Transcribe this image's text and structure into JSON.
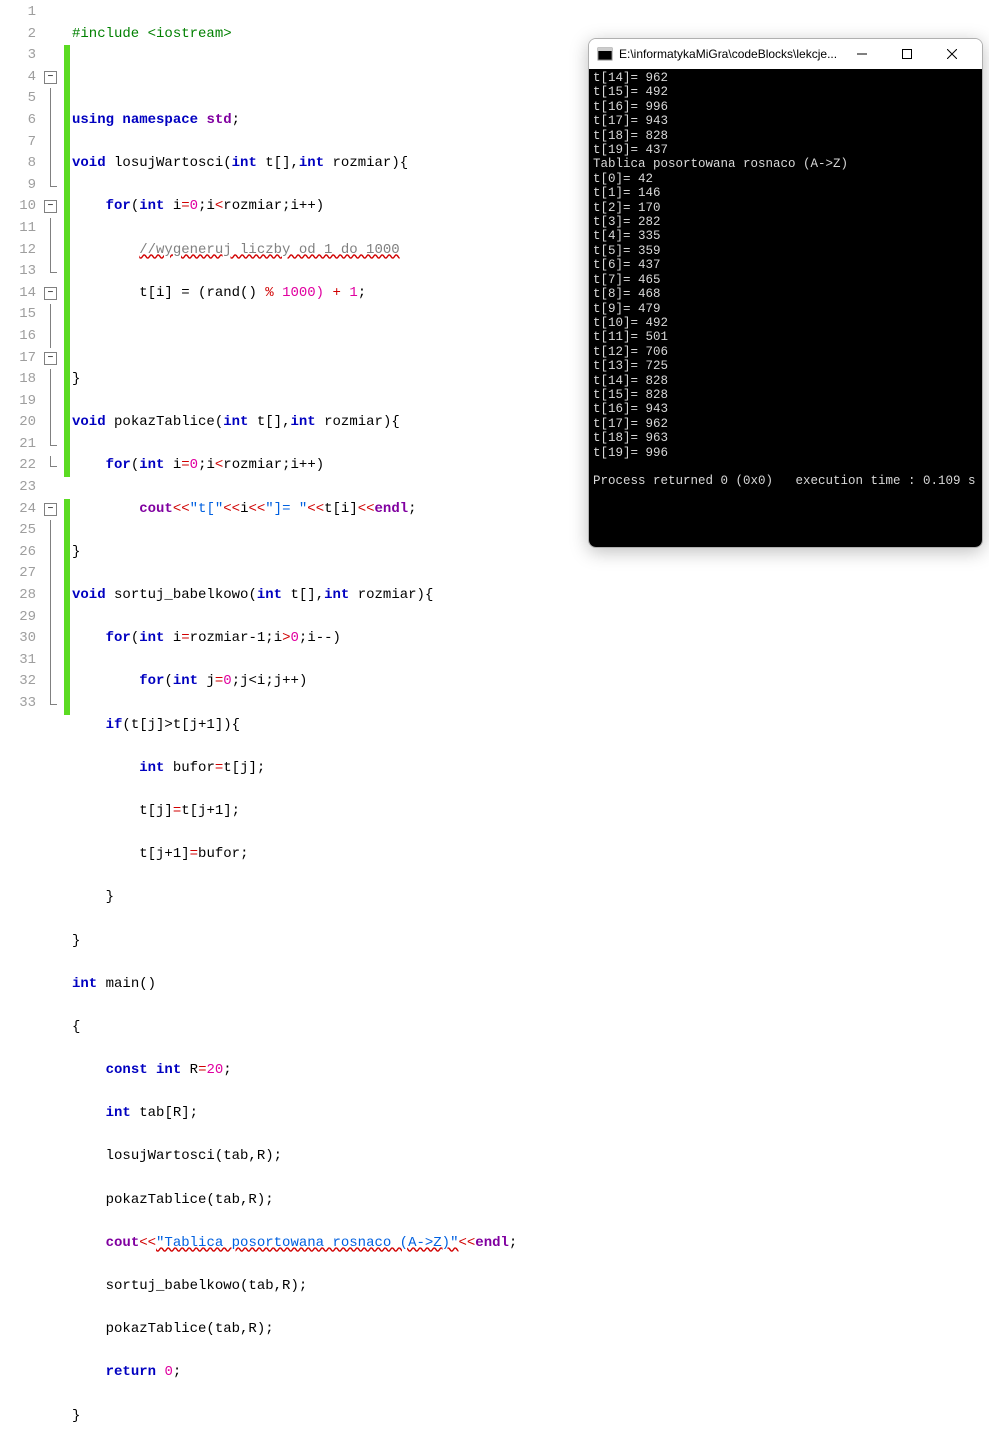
{
  "editor": {
    "lines": [
      {
        "n": 1,
        "fold": null,
        "bar": false
      },
      {
        "n": 2,
        "fold": null,
        "bar": false
      },
      {
        "n": 3,
        "fold": null,
        "bar": true
      },
      {
        "n": 4,
        "fold": "box",
        "bar": true
      },
      {
        "n": 5,
        "fold": "v",
        "bar": true
      },
      {
        "n": 6,
        "fold": "v",
        "bar": true
      },
      {
        "n": 7,
        "fold": "v",
        "bar": true
      },
      {
        "n": 8,
        "fold": "v",
        "bar": true
      },
      {
        "n": 9,
        "fold": "end",
        "bar": true
      },
      {
        "n": 10,
        "fold": "box",
        "bar": true
      },
      {
        "n": 11,
        "fold": "v",
        "bar": true
      },
      {
        "n": 12,
        "fold": "v",
        "bar": true
      },
      {
        "n": 13,
        "fold": "end",
        "bar": true
      },
      {
        "n": 14,
        "fold": "box",
        "bar": true
      },
      {
        "n": 15,
        "fold": "v",
        "bar": true
      },
      {
        "n": 16,
        "fold": "v",
        "bar": true
      },
      {
        "n": 17,
        "fold": "box",
        "bar": true
      },
      {
        "n": 18,
        "fold": "v",
        "bar": true
      },
      {
        "n": 19,
        "fold": "v",
        "bar": true
      },
      {
        "n": 20,
        "fold": "v",
        "bar": true
      },
      {
        "n": 21,
        "fold": "end",
        "bar": true
      },
      {
        "n": 22,
        "fold": "end",
        "bar": true
      },
      {
        "n": 23,
        "fold": null,
        "bar": false
      },
      {
        "n": 24,
        "fold": "box",
        "bar": true
      },
      {
        "n": 25,
        "fold": "v",
        "bar": true
      },
      {
        "n": 26,
        "fold": "v",
        "bar": true
      },
      {
        "n": 27,
        "fold": "v",
        "bar": true
      },
      {
        "n": 28,
        "fold": "v",
        "bar": true
      },
      {
        "n": 29,
        "fold": "v",
        "bar": true
      },
      {
        "n": 30,
        "fold": "v",
        "bar": true
      },
      {
        "n": 31,
        "fold": "v",
        "bar": true
      },
      {
        "n": 32,
        "fold": "v",
        "bar": true
      },
      {
        "n": 33,
        "fold": "end",
        "bar": true
      }
    ],
    "t": {
      "include": "#include <iostream>",
      "using": "using",
      "namespace": "namespace",
      "std": "std",
      "semi": ";",
      "void": "void",
      "losujWartosci": "losujWartosci",
      "lp": "(",
      "int": "int",
      "t_arr": "t[]",
      "comma": ",",
      "rozmiar": "rozmiar",
      "rp": ")",
      "lb": "{",
      "rb": "}",
      "for": "for",
      "i_decl": "i",
      "eq": "=",
      "zero": "0",
      "lt": "<",
      "ipp": "i++",
      "cm_wygen": "//wygeneruj liczby od 1 do 1000",
      "ti": "t[i]",
      "asn": " = ",
      "rand": "(rand() ",
      "pct": "%",
      " n1000": " 1000)",
      " plus": " + ",
      "one": "1",
      "pokazTablice": "pokazTablice",
      "cout": "cout",
      "ins": "<<",
      "str_tl": "\"t[\"",
      "i": "i",
      "str_eq": "\"]= \"",
      "endl": "endl",
      "sortuj": "sortuj_babelkowo",
      "rm1": "rozmiar-1",
      "gt": ">",
      "imm": "i--",
      "j": "j",
      "jlt_i": "j<i",
      "jpp": "j++",
      "if": "if",
      "cond": "(t[j]>t[j+1])",
      "bufor": "bufor",
      "tj": "t[j]",
      "tj1": "t[j+1]",
      "main": "main",
      "empty_p": "()",
      "const": "const",
      "R": "R",
      "twenty": "20",
      "tabR": "tab[R]",
      "call_losuj": "losujWartosci(tab,R);",
      "call_pokaz": "pokazTablice(tab,R);",
      "str_sorted": "\"Tablica posortowana rosnaco (A->Z)\"",
      "call_sortuj": "sortuj_babelkowo(tab,R);",
      "return": "return"
    }
  },
  "console": {
    "title": "E:\\informatykaMiGra\\codeBlocks\\lekcje...",
    "lines": [
      "t[14]= 962",
      "t[15]= 492",
      "t[16]= 996",
      "t[17]= 943",
      "t[18]= 828",
      "t[19]= 437",
      "Tablica posortowana rosnaco (A->Z)",
      "t[0]= 42",
      "t[1]= 146",
      "t[2]= 170",
      "t[3]= 282",
      "t[4]= 335",
      "t[5]= 359",
      "t[6]= 437",
      "t[7]= 465",
      "t[8]= 468",
      "t[9]= 479",
      "t[10]= 492",
      "t[11]= 501",
      "t[12]= 706",
      "t[13]= 725",
      "t[14]= 828",
      "t[15]= 828",
      "t[16]= 943",
      "t[17]= 962",
      "t[18]= 963",
      "t[19]= 996",
      "",
      "Process returned 0 (0x0)   execution time : 0.109 s"
    ]
  }
}
